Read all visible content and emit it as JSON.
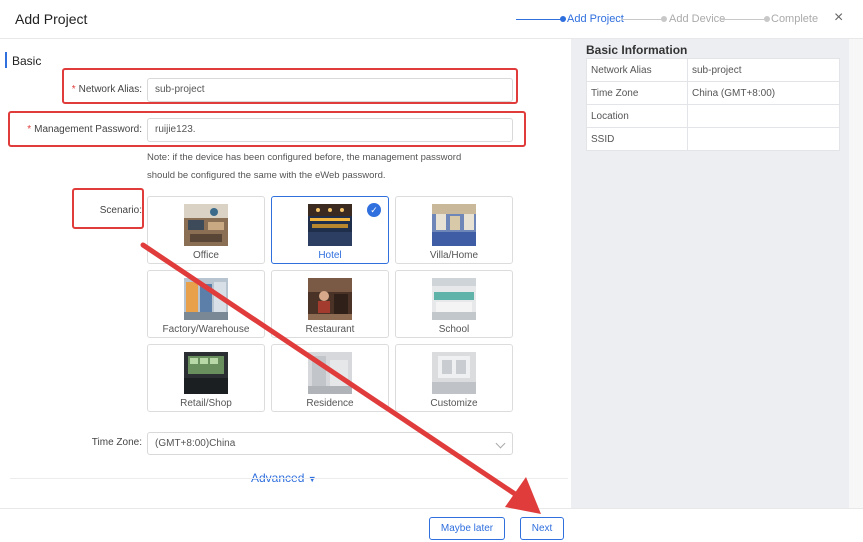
{
  "header": {
    "title": "Add Project",
    "steps": [
      {
        "label": "Add Project",
        "active": true
      },
      {
        "label": "Add Device",
        "active": false
      },
      {
        "label": "Complete",
        "active": false
      }
    ],
    "close_icon": "×"
  },
  "form": {
    "section_title": "Basic",
    "required_mark": "*",
    "network_alias": {
      "label": "Network Alias:",
      "value": "sub-project"
    },
    "management_password": {
      "label": "Management Password:",
      "value": "ruijie123."
    },
    "note_line1": "Note: if the device has been configured before, the management password",
    "note_line2": "should be configured the same with the eWeb password.",
    "scenario_label": "Scenario:",
    "scenarios": [
      {
        "name": "Office"
      },
      {
        "name": "Hotel",
        "selected": true
      },
      {
        "name": "Villa/Home"
      },
      {
        "name": "Factory/Warehouse"
      },
      {
        "name": "Restaurant"
      },
      {
        "name": "School"
      },
      {
        "name": "Retail/Shop"
      },
      {
        "name": "Residence"
      },
      {
        "name": "Customize"
      }
    ],
    "time_zone": {
      "label": "Time Zone:",
      "value": "(GMT+8:00)China"
    },
    "advanced_label": "Advanced",
    "advanced_icon": "▼"
  },
  "info": {
    "title": "Basic Information",
    "rows": [
      {
        "key": "Network Alias",
        "value": "sub-project"
      },
      {
        "key": "Time Zone",
        "value": "China (GMT+8:00)"
      },
      {
        "key": "Location",
        "value": ""
      },
      {
        "key": "SSID",
        "value": ""
      }
    ]
  },
  "footer": {
    "maybe_later": "Maybe later",
    "next": "Next"
  },
  "colors": {
    "accent": "#2f6fde",
    "highlight": "#e03c3c",
    "panel": "#eceef2"
  }
}
